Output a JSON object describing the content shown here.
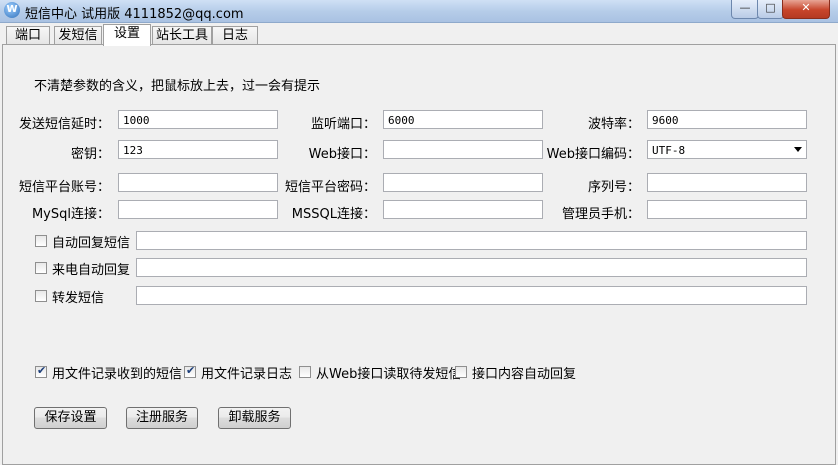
{
  "window": {
    "title": "短信中心 试用版 4111852@qq.com",
    "controls": {
      "minimize": "—",
      "maximize": "□",
      "close": "✕"
    }
  },
  "tabs": [
    {
      "label": "端口"
    },
    {
      "label": "发短信"
    },
    {
      "label": "设置"
    },
    {
      "label": "站长工具"
    },
    {
      "label": "日志"
    }
  ],
  "hint": "不清楚参数的含义，把鼠标放上去，过一会有提示",
  "form": {
    "send_delay": {
      "label": "发送短信延时：",
      "value": "1000"
    },
    "listen_port": {
      "label": "监听端口：",
      "value": "6000"
    },
    "baud_rate": {
      "label": "波特率：",
      "value": "9600"
    },
    "secret_key": {
      "label": "密钥：",
      "value": "123"
    },
    "web_interface": {
      "label": "Web接口：",
      "value": ""
    },
    "web_encoding": {
      "label": "Web接口编码：",
      "value": "UTF-8"
    },
    "sms_account": {
      "label": "短信平台账号：",
      "value": ""
    },
    "sms_password": {
      "label": "短信平台密码：",
      "value": ""
    },
    "serial_no": {
      "label": "序列号：",
      "value": ""
    },
    "mysql_conn": {
      "label": "MySql连接：",
      "value": ""
    },
    "mssql_conn": {
      "label": "MSSQL连接：",
      "value": ""
    },
    "admin_phone": {
      "label": "管理员手机：",
      "value": ""
    }
  },
  "options": {
    "auto_reply": {
      "label": "自动回复短信",
      "checked": false,
      "value": ""
    },
    "call_reply": {
      "label": "来电自动回复",
      "checked": false,
      "value": ""
    },
    "forward": {
      "label": "转发短信",
      "checked": false,
      "value": ""
    }
  },
  "flags": [
    {
      "label": "用文件记录收到的短信",
      "checked": true
    },
    {
      "label": "用文件记录日志",
      "checked": true
    },
    {
      "label": "从Web接口读取待发短信",
      "checked": false
    },
    {
      "label": "接口内容自动回复",
      "checked": false
    }
  ],
  "buttons": {
    "save": "保存设置",
    "register": "注册服务",
    "uninstall": "卸载服务"
  },
  "check_glyph": "✔"
}
